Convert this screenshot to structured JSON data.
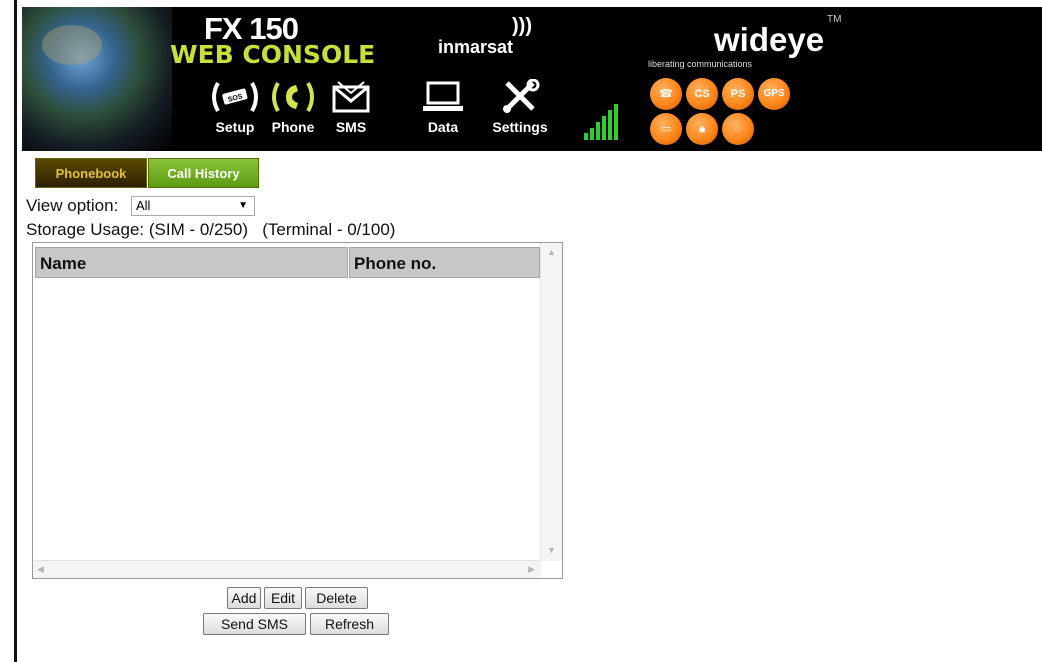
{
  "header": {
    "product_line1": "FX 150",
    "product_line2": "WEB CONSOLE",
    "partner_logo": "inmarsat",
    "brand": "wideye",
    "brand_tm": "TM",
    "tagline": "liberating communications",
    "nav": [
      {
        "label": "Setup",
        "icon": "sos-icon",
        "active": false
      },
      {
        "label": "Phone",
        "icon": "phone-icon",
        "active": true
      },
      {
        "label": "SMS",
        "icon": "envelope-icon",
        "active": false
      },
      {
        "label": "Data",
        "icon": "laptop-icon",
        "active": false
      },
      {
        "label": "Settings",
        "icon": "tools-icon",
        "active": false
      }
    ],
    "status_icons": [
      {
        "icon": "call-status-icon",
        "text": ""
      },
      {
        "icon": "cs-status-icon",
        "text": "CS"
      },
      {
        "icon": "ps-status-icon",
        "text": "PS"
      },
      {
        "icon": "gps-status-icon",
        "text": "GPS"
      },
      {
        "icon": "computer-status-icon",
        "text": ""
      },
      {
        "icon": "lock-status-icon",
        "text": ""
      },
      {
        "icon": "wireless-status-icon",
        "text": ""
      }
    ],
    "colors": {
      "accent_green": "#c8df39",
      "status_orange": "#ff8a1e",
      "signal_green": "#2fcf2f"
    }
  },
  "tabs": [
    {
      "label": "Phonebook",
      "active": true
    },
    {
      "label": "Call History",
      "active": false
    }
  ],
  "view_option": {
    "label": "View option:",
    "selected": "All"
  },
  "storage": {
    "sim": "Storage Usage: (SIM - 0/250)",
    "terminal": "(Terminal - 0/100)"
  },
  "table": {
    "columns": [
      "Name",
      "Phone no."
    ],
    "rows": []
  },
  "buttons": {
    "add": "Add",
    "edit": "Edit",
    "delete": "Delete",
    "send_sms": "Send SMS",
    "refresh": "Refresh"
  }
}
